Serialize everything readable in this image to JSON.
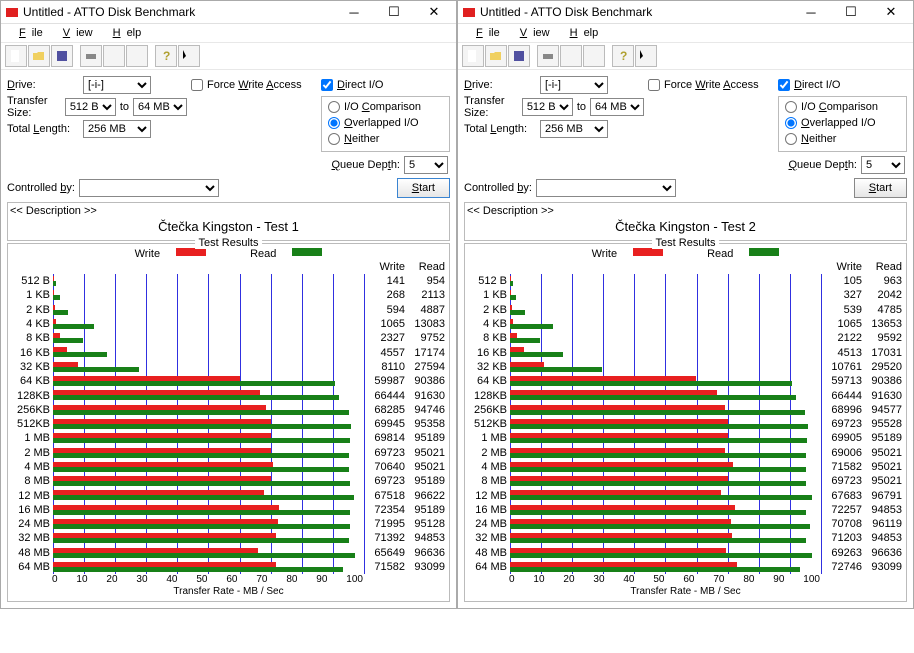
{
  "windows": [
    {
      "title": "Untitled - ATTO Disk Benchmark",
      "menu": [
        "File",
        "View",
        "Help"
      ],
      "drive": "[-i-]",
      "transfer_from": "512 B",
      "transfer_to": "64 MB",
      "total_length": "256 MB",
      "force_write": false,
      "direct_io": true,
      "io_mode": "overlapped",
      "queue_depth": "5",
      "controlled_by": "",
      "start_label": "Start",
      "desc_hd": "<< Description >>",
      "desc_txt": "Čtečka Kingston - Test 1",
      "results_title": "Test Results",
      "legend_write": "Write",
      "legend_read": "Read",
      "col_write": "Write",
      "col_read": "Read",
      "xlabel": "Transfer Rate - MB / Sec",
      "ticks": [
        "0",
        "10",
        "20",
        "30",
        "40",
        "50",
        "60",
        "70",
        "80",
        "90",
        "100"
      ]
    },
    {
      "title": "Untitled - ATTO Disk Benchmark",
      "menu": [
        "File",
        "View",
        "Help"
      ],
      "drive": "[-i-]",
      "transfer_from": "512 B",
      "transfer_to": "64 MB",
      "total_length": "256 MB",
      "force_write": false,
      "direct_io": true,
      "io_mode": "overlapped",
      "queue_depth": "5",
      "controlled_by": "",
      "start_label": "Start",
      "desc_hd": "<< Description >>",
      "desc_txt": "Čtečka Kingston - Test 2",
      "results_title": "Test Results",
      "legend_write": "Write",
      "legend_read": "Read",
      "col_write": "Write",
      "col_read": "Read",
      "xlabel": "Transfer Rate - MB / Sec",
      "ticks": [
        "0",
        "10",
        "20",
        "30",
        "40",
        "50",
        "60",
        "70",
        "80",
        "90",
        "100"
      ]
    }
  ],
  "labels": {
    "drive": "Drive:",
    "transfer_size": "Transfer Size:",
    "to": "to",
    "total_length": "Total Length:",
    "force_write": "Force Write Access",
    "direct_io": "Direct I/O",
    "io_comparison": "I/O Comparison",
    "overlapped": "Overlapped I/O",
    "neither": "Neither",
    "queue_depth": "Queue Depth:",
    "controlled_by": "Controlled by:"
  },
  "toolbar_icons": [
    "new-file-icon",
    "open-icon",
    "save-icon",
    "print-icon",
    "zoom-in-icon",
    "zoom-reset-icon",
    "help-icon",
    "whats-this-icon"
  ],
  "chart_data": [
    {
      "type": "bar",
      "title": "Test Results",
      "xlabel": "Transfer Rate - MB / Sec",
      "ylabel": "",
      "xlim": [
        0,
        100000
      ],
      "categories": [
        "512 B",
        "1 KB",
        "2 KB",
        "4 KB",
        "8 KB",
        "16 KB",
        "32 KB",
        "64 KB",
        "128KB",
        "256KB",
        "512KB",
        "1 MB",
        "2 MB",
        "4 MB",
        "8 MB",
        "12 MB",
        "16 MB",
        "24 MB",
        "32 MB",
        "48 MB",
        "64 MB"
      ],
      "series": [
        {
          "name": "Write",
          "values": [
            141,
            268,
            594,
            1065,
            2327,
            4557,
            8110,
            59987,
            66444,
            68285,
            69945,
            69814,
            69723,
            70640,
            69723,
            67518,
            72354,
            71995,
            71392,
            65649,
            71582
          ]
        },
        {
          "name": "Read",
          "values": [
            954,
            2113,
            4887,
            13083,
            9752,
            17174,
            27594,
            90386,
            91630,
            94746,
            95358,
            95189,
            95021,
            95021,
            95189,
            96622,
            95189,
            95128,
            94853,
            96636,
            93099
          ]
        }
      ]
    },
    {
      "type": "bar",
      "title": "Test Results",
      "xlabel": "Transfer Rate - MB / Sec",
      "ylabel": "",
      "xlim": [
        0,
        100000
      ],
      "categories": [
        "512 B",
        "1 KB",
        "2 KB",
        "4 KB",
        "8 KB",
        "16 KB",
        "32 KB",
        "64 KB",
        "128KB",
        "256KB",
        "512KB",
        "1 MB",
        "2 MB",
        "4 MB",
        "8 MB",
        "12 MB",
        "16 MB",
        "24 MB",
        "32 MB",
        "48 MB",
        "64 MB"
      ],
      "series": [
        {
          "name": "Write",
          "values": [
            105,
            327,
            539,
            1065,
            2122,
            4513,
            10761,
            59713,
            66444,
            68996,
            69723,
            69905,
            69006,
            71582,
            69723,
            67683,
            72257,
            70708,
            71203,
            69263,
            72746
          ]
        },
        {
          "name": "Read",
          "values": [
            963,
            2042,
            4785,
            13653,
            9592,
            17031,
            29520,
            90386,
            91630,
            94577,
            95528,
            95189,
            95021,
            95021,
            95021,
            96791,
            94853,
            96119,
            94853,
            96636,
            93099
          ]
        }
      ]
    }
  ]
}
